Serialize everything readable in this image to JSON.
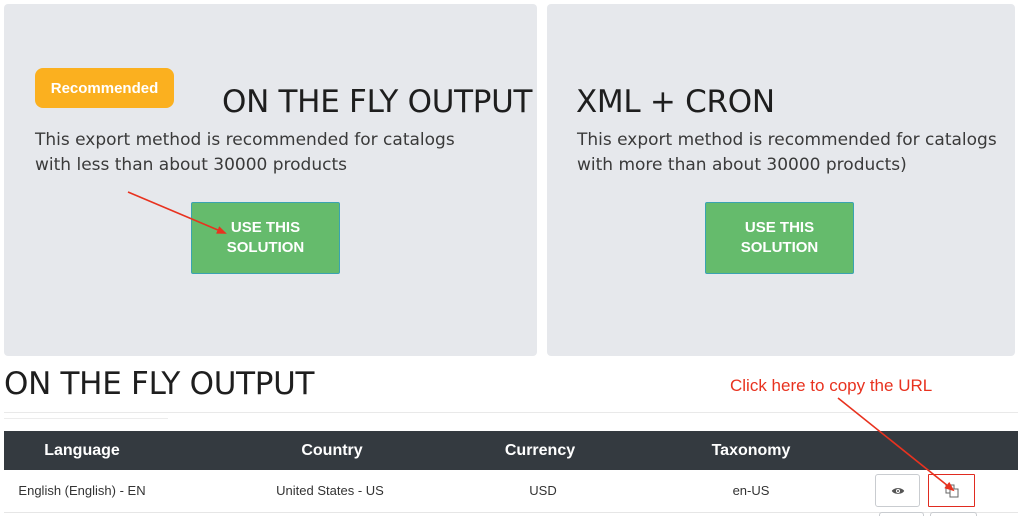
{
  "options": [
    {
      "badge": "Recommended",
      "title": "ON THE FLY OUTPUT",
      "description": "This export method is recommended for catalogs with less than about 30000 products",
      "button": "USE THIS SOLUTION"
    },
    {
      "title": "XML + CRON",
      "description": "This export method is recommended for catalogs with more than about 30000 products)",
      "button": "USE THIS SOLUTION"
    }
  ],
  "section_title": "ON THE FLY OUTPUT",
  "annotation": "Click here to copy the URL",
  "table": {
    "headers": [
      "Language",
      "Country",
      "Currency",
      "Taxonomy"
    ],
    "rows": [
      [
        "English (English) - EN",
        "United States - US",
        "USD",
        "en-US"
      ]
    ],
    "actions": [
      "eye-icon",
      "copy-icon"
    ]
  },
  "colors": {
    "badge": "#fbb01f",
    "cta": "#65bb6c",
    "header_bg": "#343a40",
    "annotation": "#e8321f"
  }
}
